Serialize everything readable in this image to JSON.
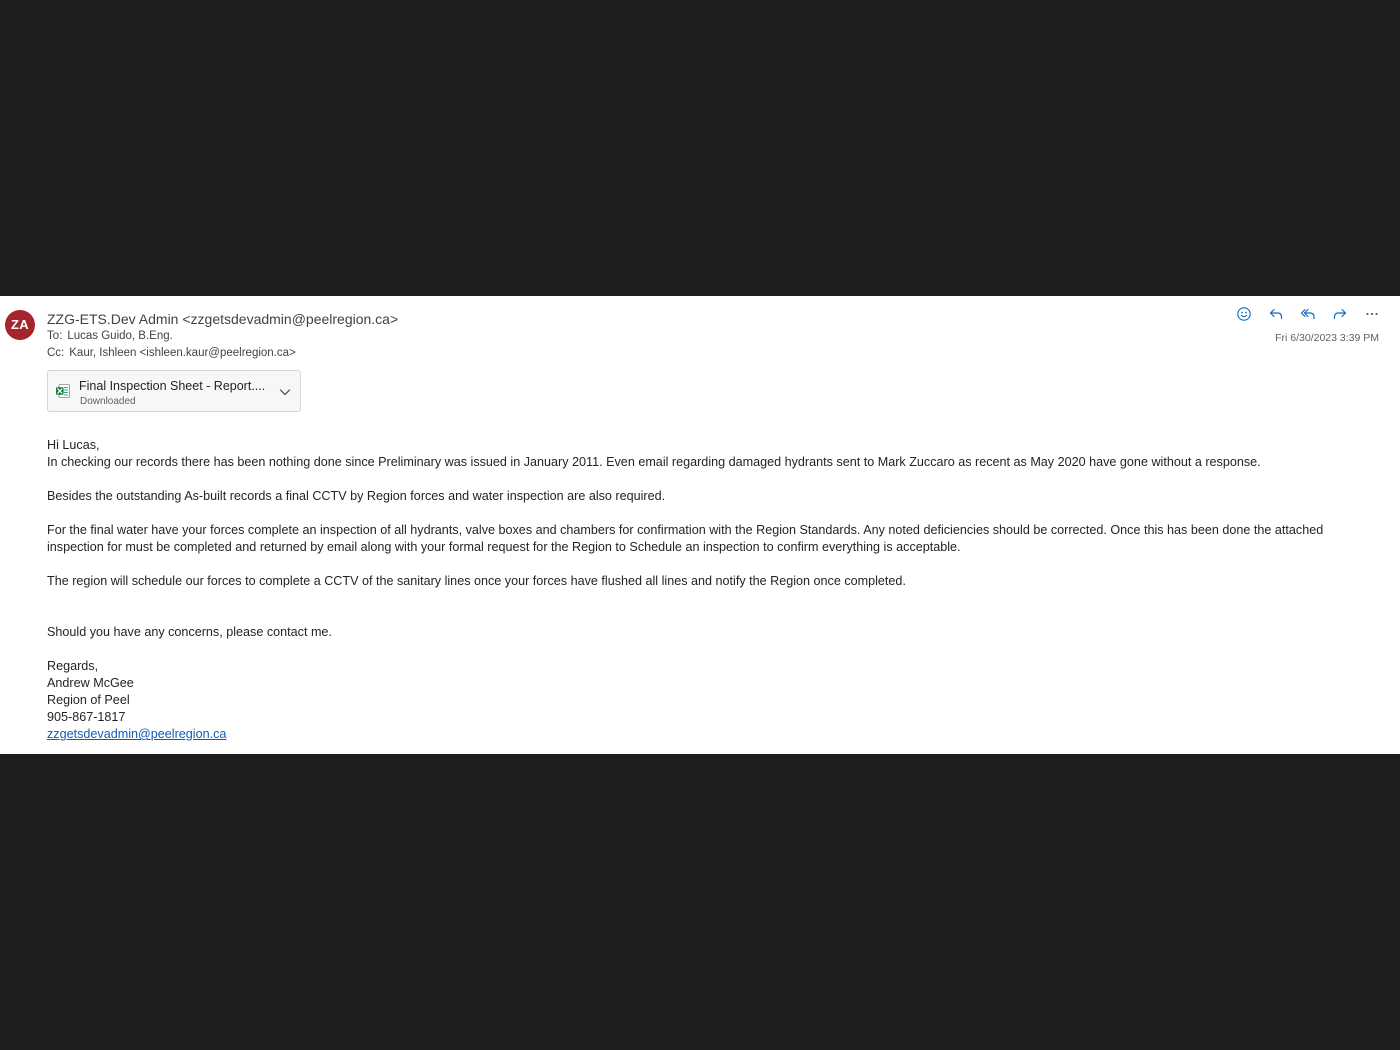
{
  "sender": {
    "avatar_initials": "ZA",
    "avatar_color": "#a4262c",
    "display": "ZZG-ETS.Dev Admin <zzgetsdevadmin@peelregion.ca>"
  },
  "recipients": {
    "to_label": "To:",
    "to_value": "Lucas Guido, B.Eng.",
    "cc_label": "Cc:",
    "cc_value": "Kaur, Ishleen <ishleen.kaur@peelregion.ca>"
  },
  "date": "Fri 6/30/2023 3:39 PM",
  "actions": [
    {
      "icon": "emoji-react-icon"
    },
    {
      "icon": "reply-icon"
    },
    {
      "icon": "reply-all-icon"
    },
    {
      "icon": "forward-icon"
    },
    {
      "icon": "more-icon"
    }
  ],
  "attachment": {
    "icon": "excel-file-icon",
    "name": "Final Inspection Sheet - Report....",
    "status": "Downloaded"
  },
  "body": {
    "greeting": "Hi Lucas,",
    "p1": "In checking our records there has been nothing done since Preliminary was issued in January 2011.  Even email regarding damaged hydrants sent to Mark Zuccaro as recent as May 2020 have gone without a response.",
    "p2": "Besides the outstanding As-built records a final CCTV by Region forces and water inspection are also required.",
    "p3": "For the final water have your forces complete an inspection of all hydrants, valve boxes and chambers for confirmation with the Region Standards.  Any noted deficiencies should be corrected.  Once this has been done the attached inspection for must be completed and returned by email along with your formal request for the Region to Schedule an inspection to confirm everything is acceptable.",
    "p4": "The region will schedule our forces to complete a CCTV of the sanitary lines once your forces have flushed all lines and notify the Region once completed.",
    "p5": "Should you have any concerns, please contact me.",
    "signoff": "Regards,",
    "sig_name": "Andrew McGee",
    "sig_org": "Region of Peel",
    "sig_phone": "905-867-1817",
    "sig_email": "zzgetsdevadmin@peelregion.ca"
  }
}
